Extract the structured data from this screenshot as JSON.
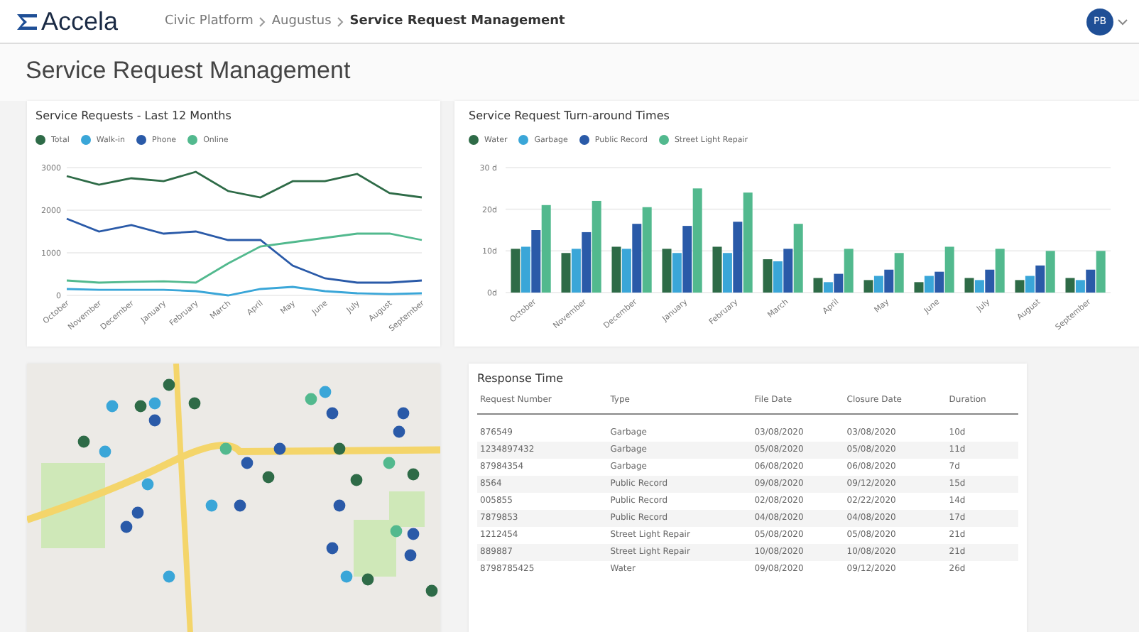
{
  "header": {
    "logo": "Accela",
    "breadcrumb": [
      "Civic Platform",
      "Augustus"
    ],
    "current": "Service Request Management",
    "avatar": "PB"
  },
  "page_title": "Service Request Management",
  "requests_chart": {
    "title": "Service Requests - Last 12 Months",
    "chart_data": {
      "type": "line",
      "categories": [
        "October",
        "November",
        "December",
        "January",
        "February",
        "March",
        "April",
        "May",
        "June",
        "July",
        "August",
        "September"
      ],
      "series": [
        {
          "name": "Total",
          "color": "#2e6b47",
          "values": [
            2800,
            2600,
            2750,
            2680,
            2900,
            2450,
            2300,
            2680,
            2680,
            2850,
            2400,
            2300
          ]
        },
        {
          "name": "Walk-in",
          "color": "#3aa6d8",
          "values": [
            150,
            130,
            130,
            130,
            100,
            0,
            150,
            200,
            100,
            50,
            30,
            50
          ]
        },
        {
          "name": "Phone",
          "color": "#2a5aa8",
          "values": [
            1800,
            1500,
            1650,
            1450,
            1500,
            1300,
            1300,
            700,
            400,
            300,
            300,
            350
          ]
        },
        {
          "name": "Online",
          "color": "#52b98e",
          "values": [
            350,
            300,
            320,
            330,
            300,
            750,
            1150,
            1250,
            1350,
            1450,
            1450,
            1300
          ]
        }
      ],
      "ylim": [
        0,
        3000
      ],
      "yticks": [
        0,
        1000,
        2000,
        3000
      ]
    }
  },
  "turnaround_chart": {
    "title": "Service Request Turn-around Times",
    "chart_data": {
      "type": "bar",
      "categories": [
        "October",
        "November",
        "December",
        "January",
        "February",
        "March",
        "April",
        "May",
        "June",
        "July",
        "August",
        "September"
      ],
      "series": [
        {
          "name": "Water",
          "color": "#2e6b47",
          "values": [
            10.5,
            9.5,
            11,
            10.5,
            11,
            8,
            3.5,
            3,
            2.5,
            3.5,
            3,
            3.5
          ]
        },
        {
          "name": "Garbage",
          "color": "#3aa6d8",
          "values": [
            11,
            10.5,
            10.5,
            9.5,
            9.5,
            7.5,
            2.5,
            4,
            4,
            3,
            4,
            3
          ]
        },
        {
          "name": "Public Record",
          "color": "#2a5aa8",
          "values": [
            15,
            14.5,
            16.5,
            16,
            17,
            10.5,
            4.5,
            5.5,
            5,
            5.5,
            6.5,
            5.5
          ]
        },
        {
          "name": "Street Light Repair",
          "color": "#52b98e",
          "values": [
            21,
            22,
            20.5,
            25,
            24,
            16.5,
            10.5,
            9.5,
            11,
            10.5,
            10,
            10
          ]
        }
      ],
      "ylim": [
        0,
        30
      ],
      "yticks": [
        {
          "value": 0,
          "label": "0d"
        },
        {
          "value": 10,
          "label": "10d"
        },
        {
          "value": 20,
          "label": "20d"
        },
        {
          "value": 30,
          "label": "30 d"
        }
      ]
    }
  },
  "response_table": {
    "title": "Response Time",
    "columns": [
      "Request Number",
      "Type",
      "File Date",
      "Closure Date",
      "Duration"
    ],
    "rows": [
      [
        "876549",
        "Garbage",
        "03/08/2020",
        "03/08/2020",
        "10d"
      ],
      [
        "1234897432",
        "Garbage",
        "05/08/2020",
        "05/08/2020",
        "11d"
      ],
      [
        "87984354",
        "Garbage",
        "06/08/2020",
        "06/08/2020",
        "7d"
      ],
      [
        "8564",
        "Public Record",
        "09/08/2020",
        "09/12/2020",
        "15d"
      ],
      [
        "005855",
        "Public Record",
        "02/08/2020",
        "02/22/2020",
        "14d"
      ],
      [
        "7879853",
        "Public Record",
        "04/08/2020",
        "04/08/2020",
        "17d"
      ],
      [
        "1212454",
        "Street Light Repair",
        "05/08/2020",
        "05/08/2020",
        "21d"
      ],
      [
        "889887",
        "Street Light Repair",
        "10/08/2020",
        "10/08/2020",
        "21d"
      ],
      [
        "8798785425",
        "Water",
        "09/08/2020",
        "09/12/2020",
        "26d"
      ]
    ]
  }
}
